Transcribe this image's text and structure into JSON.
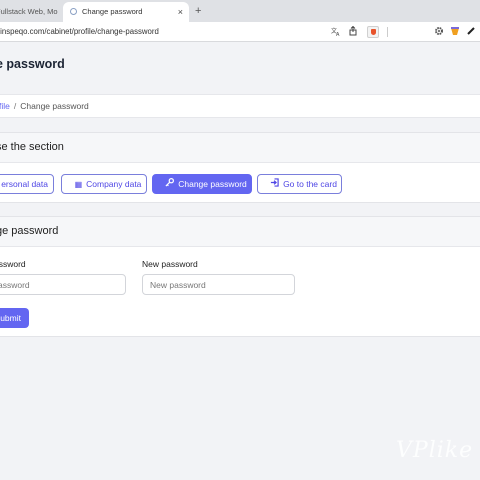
{
  "browser": {
    "tabs": [
      {
        "title": "Fullstack Web, Mo",
        "active": false
      },
      {
        "title": "Change password",
        "active": true
      }
    ],
    "new_tab": "+",
    "tab_close": "×",
    "url": ".inspeqo.com/cabinet/profile/change-password"
  },
  "page": {
    "title": "e password",
    "breadcrumb": {
      "link": "file",
      "separator": "/",
      "current": "Change password"
    }
  },
  "section_card": {
    "title": "se the section",
    "buttons": [
      {
        "label": "ersonal data",
        "icon": "user-icon",
        "active": false
      },
      {
        "label": "Company data",
        "icon": "building-icon",
        "active": false
      },
      {
        "label": "Change password",
        "icon": "key-icon",
        "active": true
      },
      {
        "label": "Go to the card",
        "icon": "sign-in-icon",
        "active": false
      }
    ]
  },
  "password_card": {
    "title": "ge password",
    "old_label": "assword",
    "old_placeholder": "assword",
    "new_label": "New password",
    "new_placeholder": "New password",
    "submit": "ubmit"
  },
  "watermark": "VPlike",
  "colors": {
    "accent": "#6366f1",
    "background": "#f2f3f6"
  }
}
